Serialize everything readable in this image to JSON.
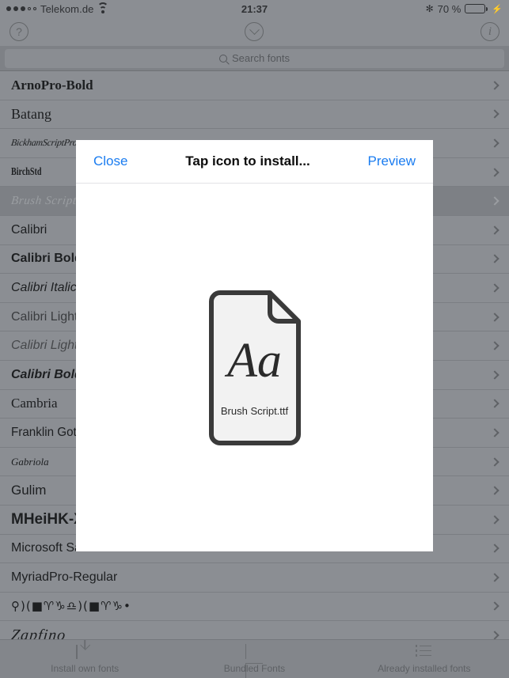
{
  "statusbar": {
    "carrier": "Telekom.de",
    "signal_dots_filled": 3,
    "signal_dots_total": 5,
    "wifi_icon": "wifi-icon",
    "time": "21:37",
    "bluetooth_icon": "bluetooth-icon",
    "battery_percent": "70 %",
    "battery_level": 70,
    "battery_color": "#4cd964",
    "charging": true
  },
  "toolbar": {
    "help_icon": "question-mark-circle-icon",
    "help_label": "?",
    "confirm_icon": "chevron-down-circle-icon",
    "info_icon": "info-circle-icon",
    "info_label": "i"
  },
  "search": {
    "icon": "search-icon",
    "placeholder": "Search fonts",
    "value": ""
  },
  "font_list": {
    "chevron_icon": "chevron-right-icon",
    "rows": [
      {
        "label": "ArnoPro-Bold",
        "style": "f-serif-bold",
        "selected": false
      },
      {
        "label": "Batang",
        "style": "f-serif",
        "selected": false
      },
      {
        "label": "BickhamScriptPro-...",
        "style": "f-script",
        "selected": false
      },
      {
        "label": "BirchStd",
        "style": "f-condensed",
        "selected": false
      },
      {
        "label": "Brush Script M...",
        "style": "f-brush",
        "selected": true
      },
      {
        "label": "Calibri",
        "style": "f-sans",
        "selected": false
      },
      {
        "label": "Calibri Bold",
        "style": "f-sans-bold",
        "selected": false
      },
      {
        "label": "Calibri Italic",
        "style": "f-sans-ital",
        "selected": false
      },
      {
        "label": "Calibri Light",
        "style": "f-sans-light",
        "selected": false
      },
      {
        "label": "Calibri Light It...",
        "style": "f-sans-lightital",
        "selected": false
      },
      {
        "label": "Calibri Bold It...",
        "style": "f-sans-boldital",
        "selected": false
      },
      {
        "label": "Cambria",
        "style": "f-cambria",
        "selected": false
      },
      {
        "label": "Franklin Goth...",
        "style": "f-franklin",
        "selected": false
      },
      {
        "label": "Gabriola",
        "style": "f-gabriola",
        "selected": false
      },
      {
        "label": "Gulim",
        "style": "f-gulim",
        "selected": false
      },
      {
        "label": "MHeiHK-Xb...",
        "style": "f-mhei",
        "selected": false
      },
      {
        "label": "Microsoft Sans Serif",
        "style": "f-mssans",
        "selected": false
      },
      {
        "label": "MyriadPro-Regular",
        "style": "f-myriad",
        "selected": false
      },
      {
        "label": "⚲)(■♈♑♎)(■♈♑•",
        "style": "f-symbol",
        "selected": false
      },
      {
        "label": "Zapfino",
        "style": "f-zapfino",
        "selected": false
      }
    ]
  },
  "modal": {
    "close_label": "Close",
    "title": "Tap icon to install...",
    "preview_label": "Preview",
    "file_icon": "document-file-icon",
    "file_sample_text": "Aa",
    "file_name": "Brush Script.ttf"
  },
  "tabbar": {
    "tabs": [
      {
        "label": "Install own fonts",
        "icon": "download-icon"
      },
      {
        "label": "Bundled Fonts",
        "icon": "box-icon"
      },
      {
        "label": "Already installed fonts",
        "icon": "list-icon"
      }
    ]
  }
}
